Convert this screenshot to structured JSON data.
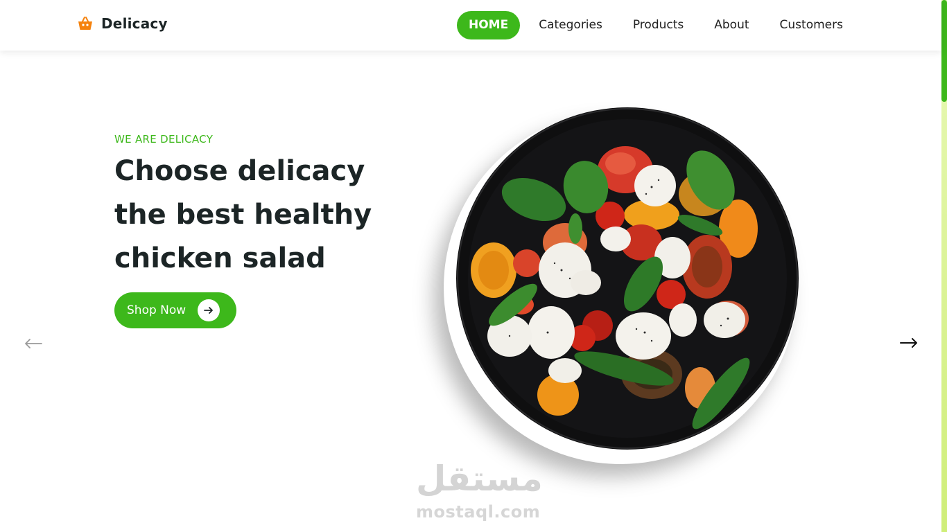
{
  "brand": {
    "name": "Delicacy",
    "icon": "basket-icon",
    "icon_color": "#f5820d"
  },
  "nav": {
    "items": [
      {
        "label": "HOME",
        "active": true
      },
      {
        "label": "Categories",
        "active": false
      },
      {
        "label": "Products",
        "active": false
      },
      {
        "label": "About",
        "active": false
      },
      {
        "label": "Customers",
        "active": false
      }
    ]
  },
  "hero": {
    "eyebrow": "WE ARE DELICACY",
    "headline_lines": [
      "Choose delicacy",
      "the best healthy",
      "chicken salad"
    ],
    "cta_label": "Shop Now",
    "cta_icon": "arrow-right-icon",
    "image_alt": "salad-plate"
  },
  "carousel": {
    "prev_icon": "arrow-left-icon",
    "next_icon": "arrow-right-icon"
  },
  "watermark": {
    "arabic": "مستقل",
    "text": "mostaql.com"
  },
  "colors": {
    "accent": "#3db81b",
    "text": "#1c2526",
    "brand_icon": "#f5820d"
  }
}
